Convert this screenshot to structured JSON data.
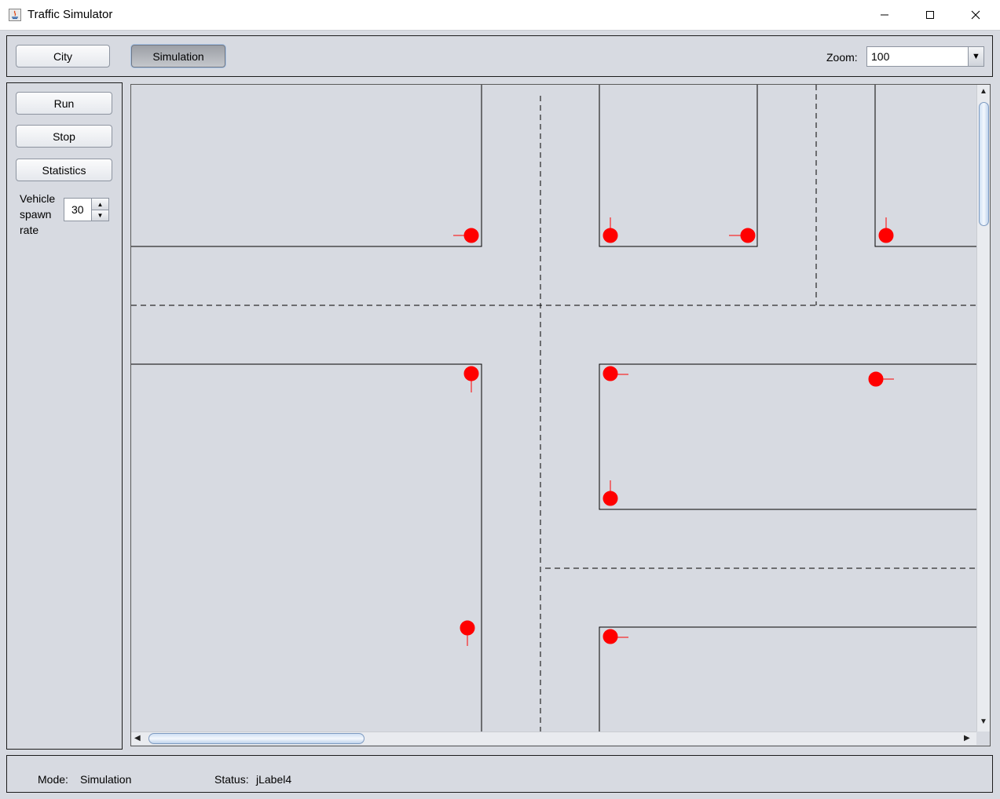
{
  "window": {
    "title": "Traffic Simulator"
  },
  "mode_tabs": {
    "city_label": "City",
    "simulation_label": "Simulation"
  },
  "zoom": {
    "label": "Zoom:",
    "value": "100"
  },
  "controls": {
    "run_label": "Run",
    "stop_label": "Stop",
    "statistics_label": "Statistics",
    "spawn_label_line1": "Vehicle",
    "spawn_label_line2": "spawn",
    "spawn_label_line3": "rate",
    "spawn_rate": "30"
  },
  "status_bar": {
    "mode_label": "Mode:",
    "mode_value": "Simulation",
    "status_label": "Status:",
    "status_value": "jLabel4"
  },
  "colors": {
    "vehicle": "#ff0000",
    "background": "#d7dae1"
  }
}
